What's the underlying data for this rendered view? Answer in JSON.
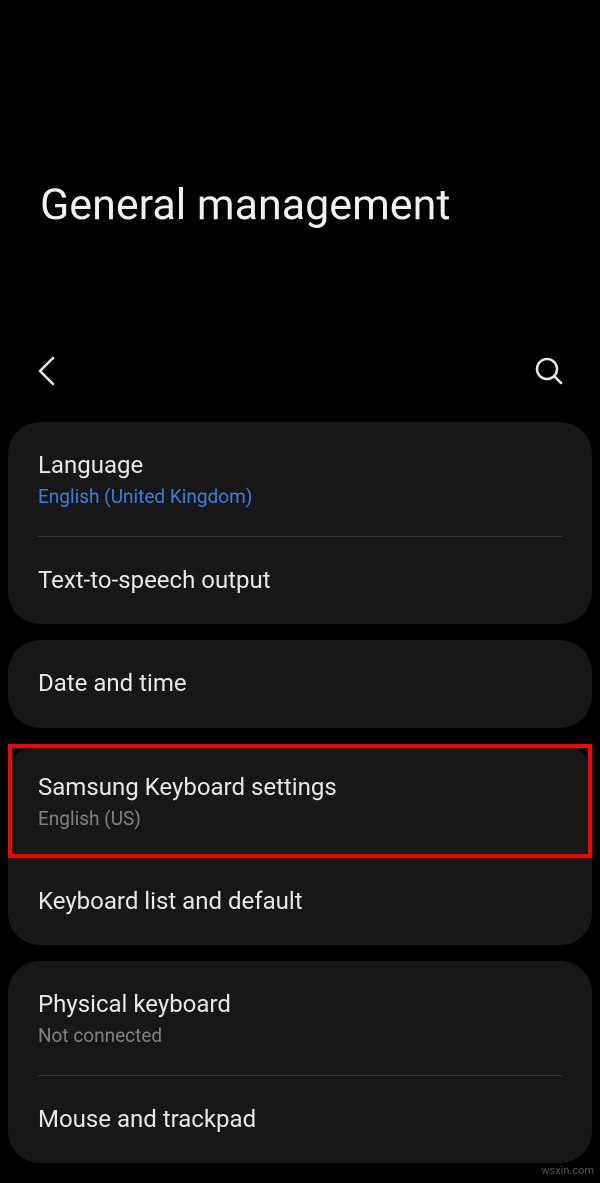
{
  "page_title": "General management",
  "items": {
    "language": {
      "title": "Language",
      "subtitle": "English (United Kingdom)"
    },
    "tts": {
      "title": "Text-to-speech output"
    },
    "date_time": {
      "title": "Date and time"
    },
    "samsung_keyboard": {
      "title": "Samsung Keyboard settings",
      "subtitle": "English (US)"
    },
    "keyboard_list": {
      "title": "Keyboard list and default"
    },
    "physical_keyboard": {
      "title": "Physical keyboard",
      "subtitle": "Not connected"
    },
    "mouse_trackpad": {
      "title": "Mouse and trackpad"
    }
  },
  "watermark": "wsxin.com"
}
